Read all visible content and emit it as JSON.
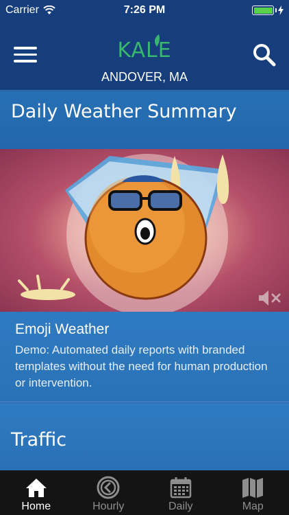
{
  "status_bar": {
    "carrier": "Carrier",
    "time": "7:26 PM",
    "battery_level": 1.0
  },
  "header": {
    "logo": "KALE",
    "location": "ANDOVER, MA",
    "menu_icon": "hamburger-menu-icon",
    "search_icon": "search-icon"
  },
  "sections": {
    "daily_summary_title": "Daily Weather Summary",
    "video": {
      "title": "Emoji Weather",
      "description": "Demo: Automated daily reports with branded templates without the need for human production or intervention.",
      "muted": true
    },
    "traffic_title": "Traffic"
  },
  "tab_bar": {
    "tabs": [
      {
        "label": "Home",
        "icon": "home-icon",
        "active": true
      },
      {
        "label": "Hourly",
        "icon": "clock-icon",
        "active": false
      },
      {
        "label": "Daily",
        "icon": "calendar-icon",
        "active": false
      },
      {
        "label": "Map",
        "icon": "map-icon",
        "active": false
      }
    ]
  },
  "colors": {
    "header_bg": "#173e7c",
    "logo_green": "#37b86c",
    "content_blue": "#2770b5",
    "battery_green": "#58d24a",
    "tabbar_bg": "#141414"
  }
}
